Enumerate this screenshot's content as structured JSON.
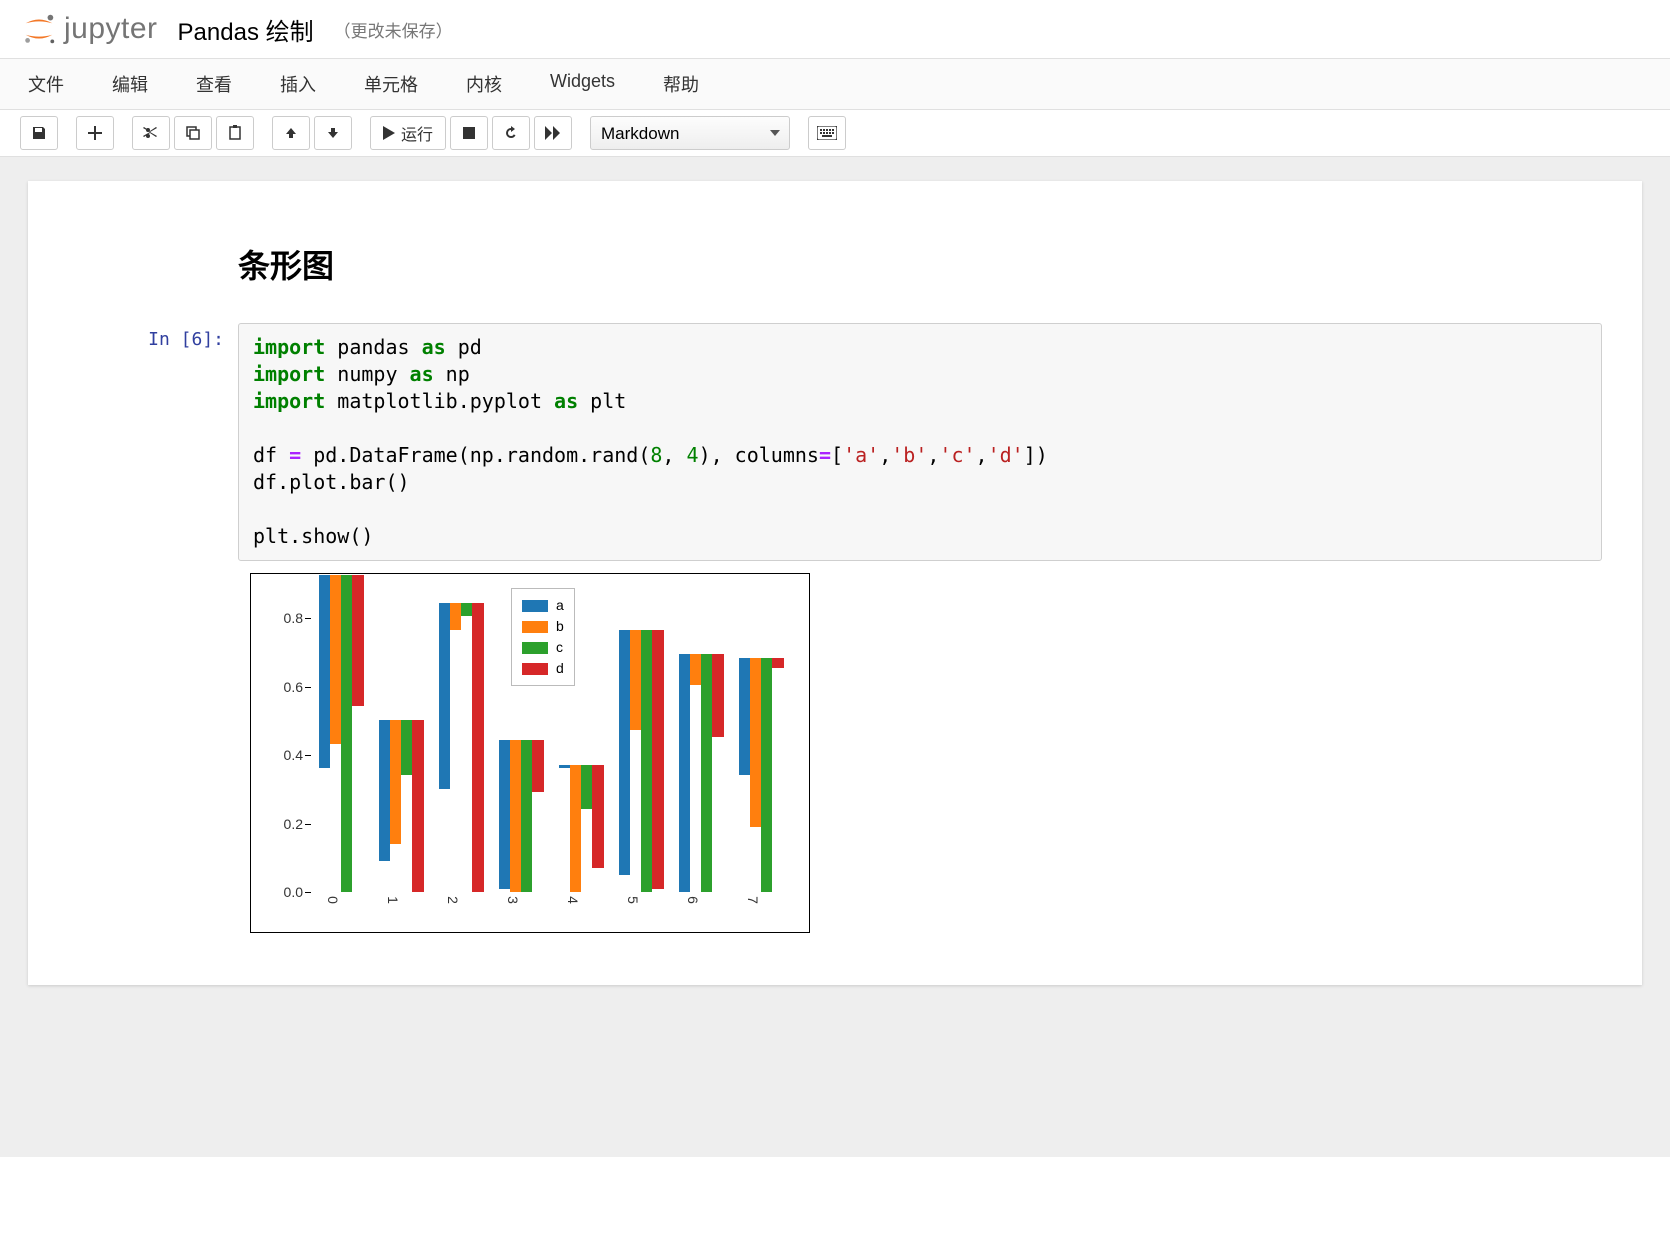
{
  "header": {
    "logo_text": "jupyter",
    "notebook_title": "Pandas 绘制",
    "save_status": "（更改未保存）"
  },
  "menubar": [
    "文件",
    "编辑",
    "查看",
    "插入",
    "单元格",
    "内核",
    "Widgets",
    "帮助"
  ],
  "toolbar": {
    "run_label": "运行",
    "cell_type": "Markdown"
  },
  "markdown_heading": "条形图",
  "code_cell": {
    "prompt": "In [6]:",
    "code_tokens": [
      {
        "t": "import ",
        "c": "kw"
      },
      {
        "t": "pandas "
      },
      {
        "t": "as ",
        "c": "kw"
      },
      {
        "t": "pd\n"
      },
      {
        "t": "import ",
        "c": "kw"
      },
      {
        "t": "numpy "
      },
      {
        "t": "as ",
        "c": "kw"
      },
      {
        "t": "np\n"
      },
      {
        "t": "import ",
        "c": "kw"
      },
      {
        "t": "matplotlib.pyplot "
      },
      {
        "t": "as ",
        "c": "kw"
      },
      {
        "t": "plt\n"
      },
      {
        "t": "\n"
      },
      {
        "t": "df "
      },
      {
        "t": "= ",
        "c": "op"
      },
      {
        "t": "pd.DataFrame(np.random.rand("
      },
      {
        "t": "8",
        "c": "num"
      },
      {
        "t": ", "
      },
      {
        "t": "4",
        "c": "num"
      },
      {
        "t": "), columns"
      },
      {
        "t": "=",
        "c": "op"
      },
      {
        "t": "["
      },
      {
        "t": "'a'",
        "c": "str"
      },
      {
        "t": ","
      },
      {
        "t": "'b'",
        "c": "str"
      },
      {
        "t": ","
      },
      {
        "t": "'c'",
        "c": "str"
      },
      {
        "t": ","
      },
      {
        "t": "'d'",
        "c": "str"
      },
      {
        "t": "])\n"
      },
      {
        "t": "df.plot.bar()\n"
      },
      {
        "t": "\n"
      },
      {
        "t": "plt.show()"
      }
    ]
  },
  "chart_data": {
    "type": "bar",
    "categories": [
      "0",
      "1",
      "2",
      "3",
      "4",
      "5",
      "6",
      "7"
    ],
    "series": [
      {
        "name": "a",
        "color": "#1f77b4",
        "values": [
          0.56,
          0.41,
          0.54,
          0.43,
          0.01,
          0.71,
          0.69,
          0.34
        ]
      },
      {
        "name": "b",
        "color": "#ff7f0e",
        "values": [
          0.49,
          0.36,
          0.08,
          0.44,
          0.37,
          0.29,
          0.09,
          0.49
        ]
      },
      {
        "name": "c",
        "color": "#2ca02c",
        "values": [
          0.92,
          0.16,
          0.04,
          0.44,
          0.13,
          0.76,
          0.69,
          0.68
        ]
      },
      {
        "name": "d",
        "color": "#d62728",
        "values": [
          0.38,
          0.5,
          0.84,
          0.15,
          0.3,
          0.75,
          0.24,
          0.03
        ]
      }
    ],
    "ylim": [
      0.0,
      0.9
    ],
    "yticks": [
      0.0,
      0.2,
      0.4,
      0.6,
      0.8
    ],
    "xlabel": "",
    "ylabel": "",
    "legend_position": "top-center"
  }
}
